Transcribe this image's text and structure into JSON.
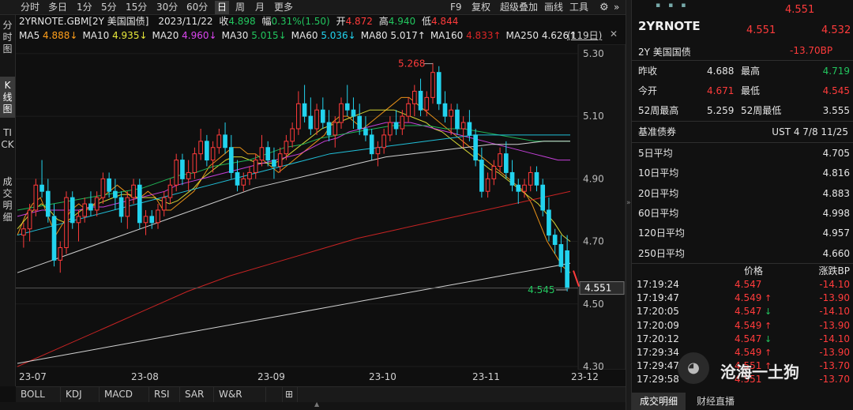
{
  "toolbar": {
    "periods": [
      "分时",
      "多日",
      "1分",
      "5分",
      "15分",
      "30分",
      "60分",
      "日",
      "周",
      "月",
      "更多"
    ],
    "active_period": "日",
    "right_items": [
      "F9",
      "复权",
      "超级叠加",
      "画线",
      "工具"
    ]
  },
  "vtabs": [
    "分时图",
    "K线图",
    "TICK",
    "成交明细"
  ],
  "info": {
    "symbol": "2YRNOTE.GBM[2Y 美国国债]",
    "date": "2023/11/22",
    "close_label": "收",
    "close": "4.898",
    "change_label": "幅",
    "change": "0.31%(1.50)",
    "open_label": "开",
    "open": "4.872",
    "high_label": "高",
    "high": "4.940",
    "low_label": "低",
    "low": "4.844"
  },
  "ma_line": [
    {
      "label": "MA5",
      "value": "4.888↓",
      "color": "#ff9f1a"
    },
    {
      "label": "MA10",
      "value": "4.935↓",
      "color": "#e8e83a"
    },
    {
      "label": "MA20",
      "value": "4.960↓",
      "color": "#d946ef"
    },
    {
      "label": "MA30",
      "value": "5.015↓",
      "color": "#22c55e"
    },
    {
      "label": "MA60",
      "value": "5.036↓",
      "color": "#22d3ee"
    },
    {
      "label": "MA80",
      "value": "5.017↑",
      "color": "#e5e5e5"
    },
    {
      "label": "MA160",
      "value": "4.833↑",
      "color": "#dc2626"
    },
    {
      "label": "MA250",
      "value": "4.626↑",
      "color": "#e5e5e5"
    }
  ],
  "window_label": "(119日)",
  "price_axis": [
    "5.30",
    "5.10",
    "4.90",
    "4.70",
    "4.50",
    "4.30"
  ],
  "date_axis": [
    "23-07",
    "23-08",
    "23-09",
    "23-10",
    "23-11",
    "23-12"
  ],
  "annotations": {
    "high_label": "5.268",
    "low_label": "4.545",
    "last_price": "4.551"
  },
  "indicators": [
    "BOLL",
    "KDJ",
    "MACD",
    "RSI",
    "SAR",
    "W&R",
    "⊞"
  ],
  "quote": {
    "price_top": "4.551",
    "name": "2YRNOTE",
    "price": "4.551",
    "price_prev": "4.532",
    "subname": "2Y 美国国债",
    "change_bp": "-13.70BP",
    "rows": [
      {
        "l1": "昨收",
        "v1": "4.688",
        "c1": "#e5e5e5",
        "l2": "最高",
        "v2": "4.719",
        "c2": "#22c55e"
      },
      {
        "l1": "今开",
        "v1": "4.671",
        "c1": "#ff3b3b",
        "l2": "最低",
        "v2": "4.545",
        "c2": "#ff3b3b"
      },
      {
        "l1": "52周最高",
        "v1": "5.259",
        "c1": "#e5e5e5",
        "l2": "52周最低",
        "v2": "3.555",
        "c2": "#e5e5e5"
      }
    ],
    "bench_label": "基准债券",
    "bench_value": "UST 4 7/8 11/25",
    "averages": [
      {
        "label": "5日平均",
        "value": "4.705"
      },
      {
        "label": "10日平均",
        "value": "4.816"
      },
      {
        "label": "20日平均",
        "value": "4.883"
      },
      {
        "label": "60日平均",
        "value": "4.998"
      },
      {
        "label": "120日平均",
        "value": "4.957"
      },
      {
        "label": "250日平均",
        "value": "4.660"
      }
    ],
    "tick_header": {
      "price": "价格",
      "bp": "涨跌BP"
    },
    "ticks": [
      {
        "time": "17:19:24",
        "price": "4.547",
        "arrow": "",
        "bp": "-14.10"
      },
      {
        "time": "17:19:47",
        "price": "4.549",
        "arrow": "up",
        "bp": "-13.90"
      },
      {
        "time": "17:20:05",
        "price": "4.547",
        "arrow": "down",
        "bp": "-14.10"
      },
      {
        "time": "17:20:09",
        "price": "4.549",
        "arrow": "up",
        "bp": "-13.90"
      },
      {
        "time": "17:20:12",
        "price": "4.547",
        "arrow": "down",
        "bp": "-14.10"
      },
      {
        "time": "17:29:34",
        "price": "4.549",
        "arrow": "up",
        "bp": "-13.90"
      },
      {
        "time": "17:29:47",
        "price": "4.551",
        "arrow": "up",
        "bp": "-13.70"
      },
      {
        "time": "17:29:58",
        "price": "4.551",
        "arrow": "",
        "bp": "-13.70"
      }
    ],
    "bottom_tabs": [
      "成交明细",
      "财经直播"
    ],
    "watermark": "沧海一土狗"
  },
  "chart_data": {
    "type": "candlestick",
    "ylim": [
      4.3,
      5.32
    ],
    "candles": [
      [
        4.72,
        4.76,
        4.68,
        4.74
      ],
      [
        4.74,
        4.82,
        4.7,
        4.8
      ],
      [
        4.8,
        4.9,
        4.78,
        4.88
      ],
      [
        4.88,
        4.96,
        4.84,
        4.86
      ],
      [
        4.86,
        4.9,
        4.76,
        4.78
      ],
      [
        4.78,
        4.82,
        4.62,
        4.64
      ],
      [
        4.64,
        4.7,
        4.6,
        4.68
      ],
      [
        4.68,
        4.86,
        4.66,
        4.84
      ],
      [
        4.84,
        4.86,
        4.74,
        4.76
      ],
      [
        4.76,
        4.8,
        4.7,
        4.78
      ],
      [
        4.78,
        4.84,
        4.76,
        4.82
      ],
      [
        4.82,
        4.86,
        4.78,
        4.8
      ],
      [
        4.8,
        4.86,
        4.78,
        4.84
      ],
      [
        4.84,
        4.92,
        4.82,
        4.9
      ],
      [
        4.9,
        4.92,
        4.84,
        4.86
      ],
      [
        4.86,
        4.9,
        4.8,
        4.84
      ],
      [
        4.84,
        4.86,
        4.76,
        4.78
      ],
      [
        4.78,
        4.86,
        4.74,
        4.84
      ],
      [
        4.84,
        4.9,
        4.82,
        4.88
      ],
      [
        4.88,
        4.9,
        4.74,
        4.76
      ],
      [
        4.76,
        4.8,
        4.72,
        4.78
      ],
      [
        4.78,
        4.8,
        4.74,
        4.76
      ],
      [
        4.76,
        4.82,
        4.74,
        4.8
      ],
      [
        4.8,
        4.86,
        4.78,
        4.84
      ],
      [
        4.84,
        4.9,
        4.82,
        4.88
      ],
      [
        4.88,
        4.98,
        4.86,
        4.96
      ],
      [
        4.96,
        4.98,
        4.88,
        4.9
      ],
      [
        4.9,
        4.96,
        4.86,
        4.92
      ],
      [
        4.92,
        5.0,
        4.9,
        4.98
      ],
      [
        4.98,
        5.06,
        4.96,
        5.02
      ],
      [
        5.02,
        5.04,
        4.94,
        4.96
      ],
      [
        4.96,
        5.02,
        4.92,
        5.0
      ],
      [
        5.0,
        5.06,
        4.98,
        5.04
      ],
      [
        5.04,
        5.08,
        4.98,
        5.0
      ],
      [
        5.0,
        5.04,
        4.9,
        4.92
      ],
      [
        4.92,
        4.96,
        4.86,
        4.88
      ],
      [
        4.88,
        4.92,
        4.86,
        4.9
      ],
      [
        4.9,
        4.94,
        4.88,
        4.92
      ],
      [
        4.92,
        4.98,
        4.9,
        4.96
      ],
      [
        4.96,
        5.04,
        4.94,
        5.0
      ],
      [
        5.0,
        5.02,
        4.94,
        4.96
      ],
      [
        4.96,
        5.0,
        4.9,
        4.94
      ],
      [
        4.94,
        5.0,
        4.92,
        4.98
      ],
      [
        4.98,
        5.04,
        4.96,
        5.02
      ],
      [
        5.02,
        5.08,
        5.0,
        5.06
      ],
      [
        5.06,
        5.18,
        5.04,
        5.14
      ],
      [
        5.14,
        5.2,
        5.08,
        5.1
      ],
      [
        5.1,
        5.16,
        5.04,
        5.06
      ],
      [
        5.06,
        5.14,
        5.04,
        5.12
      ],
      [
        5.12,
        5.16,
        5.06,
        5.08
      ],
      [
        5.08,
        5.12,
        5.02,
        5.04
      ],
      [
        5.04,
        5.1,
        5.0,
        5.08
      ],
      [
        5.08,
        5.16,
        5.06,
        5.14
      ],
      [
        5.14,
        5.2,
        5.1,
        5.12
      ],
      [
        5.12,
        5.16,
        5.06,
        5.1
      ],
      [
        5.1,
        5.14,
        5.04,
        5.06
      ],
      [
        5.06,
        5.1,
        5.02,
        5.04
      ],
      [
        5.04,
        5.06,
        4.96,
        4.98
      ],
      [
        4.98,
        5.02,
        4.94,
        5.0
      ],
      [
        5.0,
        5.06,
        4.98,
        5.04
      ],
      [
        5.04,
        5.1,
        5.02,
        5.08
      ],
      [
        5.08,
        5.12,
        5.04,
        5.06
      ],
      [
        5.06,
        5.12,
        5.04,
        5.1
      ],
      [
        5.1,
        5.16,
        5.08,
        5.14
      ],
      [
        5.14,
        5.2,
        5.1,
        5.18
      ],
      [
        5.18,
        5.22,
        5.1,
        5.12
      ],
      [
        5.12,
        5.18,
        5.1,
        5.16
      ],
      [
        5.16,
        5.27,
        5.14,
        5.24
      ],
      [
        5.24,
        5.26,
        5.12,
        5.14
      ],
      [
        5.14,
        5.18,
        5.08,
        5.1
      ],
      [
        5.1,
        5.14,
        5.04,
        5.12
      ],
      [
        5.12,
        5.14,
        5.04,
        5.06
      ],
      [
        5.06,
        5.1,
        5.0,
        5.08
      ],
      [
        5.08,
        5.12,
        5.02,
        5.04
      ],
      [
        5.04,
        5.06,
        4.94,
        4.96
      ],
      [
        4.96,
        5.0,
        4.84,
        4.86
      ],
      [
        4.86,
        4.92,
        4.84,
        4.9
      ],
      [
        4.9,
        4.96,
        4.88,
        4.94
      ],
      [
        4.94,
        5.0,
        4.92,
        4.98
      ],
      [
        4.98,
        5.02,
        4.9,
        4.92
      ],
      [
        4.92,
        4.96,
        4.86,
        4.88
      ],
      [
        4.88,
        4.9,
        4.82,
        4.86
      ],
      [
        4.86,
        4.9,
        4.84,
        4.88
      ],
      [
        4.88,
        4.94,
        4.86,
        4.92
      ],
      [
        4.92,
        4.94,
        4.86,
        4.88
      ],
      [
        4.88,
        4.9,
        4.78,
        4.8
      ],
      [
        4.8,
        4.84,
        4.7,
        4.72
      ],
      [
        4.72,
        4.74,
        4.66,
        4.69
      ],
      [
        4.69,
        4.72,
        4.6,
        4.62
      ],
      [
        4.67,
        4.72,
        4.54,
        4.55
      ]
    ],
    "ma_lines": [
      {
        "name": "MA5",
        "color": "#ff9f1a",
        "values": [
          4.72,
          4.78,
          4.82,
          4.84,
          4.78,
          4.72,
          4.76,
          4.8,
          4.82,
          4.8,
          4.82,
          4.84,
          4.86,
          4.88,
          4.86,
          4.84,
          4.84,
          4.86,
          4.84,
          4.8,
          4.8,
          4.82,
          4.84,
          4.86,
          4.9,
          4.94,
          4.96,
          4.98,
          5.0,
          5.0,
          4.98,
          4.98,
          4.96,
          4.94,
          4.92,
          4.94,
          4.96,
          4.98,
          5.0,
          5.02,
          5.04,
          5.08,
          5.1,
          5.1,
          5.08,
          5.06,
          5.08,
          5.1,
          5.12,
          5.14,
          5.16,
          5.16,
          5.14,
          5.12,
          5.1,
          5.08,
          5.06,
          5.04,
          5.02,
          5.0,
          4.98,
          4.96,
          4.94,
          4.92,
          4.9,
          4.88,
          4.86,
          4.82,
          4.76,
          4.7,
          4.66,
          4.62,
          4.6
        ]
      },
      {
        "name": "MA10",
        "color": "#e8e83a",
        "values": [
          4.74,
          4.77,
          4.8,
          4.82,
          4.8,
          4.77,
          4.76,
          4.78,
          4.8,
          4.81,
          4.82,
          4.83,
          4.84,
          4.85,
          4.85,
          4.84,
          4.84,
          4.84,
          4.83,
          4.82,
          4.83,
          4.85,
          4.87,
          4.9,
          4.92,
          4.94,
          4.96,
          4.97,
          4.97,
          4.96,
          4.95,
          4.95,
          4.95,
          4.96,
          4.98,
          5.0,
          5.02,
          5.04,
          5.06,
          5.07,
          5.08,
          5.09,
          5.1,
          5.11,
          5.12,
          5.12,
          5.12,
          5.12,
          5.11,
          5.1,
          5.09,
          5.08,
          5.06,
          5.05,
          5.03,
          5.01,
          4.99,
          4.97,
          4.95,
          4.93,
          4.92,
          4.9,
          4.88,
          4.86,
          4.84,
          4.82,
          4.79,
          4.76,
          4.72,
          4.7
        ]
      },
      {
        "name": "MA20",
        "color": "#d946ef",
        "values": [
          4.78,
          4.79,
          4.8,
          4.8,
          4.8,
          4.8,
          4.81,
          4.81,
          4.82,
          4.83,
          4.84,
          4.85,
          4.86,
          4.88,
          4.89,
          4.9,
          4.91,
          4.92,
          4.93,
          4.94,
          4.95,
          4.96,
          4.97,
          4.98,
          5.0,
          5.02,
          5.03,
          5.05,
          5.06,
          5.07,
          5.08,
          5.08,
          5.08,
          5.07,
          5.06,
          5.05,
          5.04,
          5.03,
          5.02,
          5.01,
          5.0,
          4.99,
          4.98,
          4.97,
          4.96,
          4.96
        ]
      },
      {
        "name": "MA30",
        "color": "#22c55e",
        "values": [
          4.8,
          4.81,
          4.82,
          4.83,
          4.84,
          4.85,
          4.86,
          4.87,
          4.89,
          4.91,
          4.92,
          4.94,
          4.95,
          4.96,
          4.98,
          5.0,
          5.01,
          5.03,
          5.04,
          5.05,
          5.06,
          5.07,
          5.07,
          5.07,
          5.06,
          5.06,
          5.05,
          5.04,
          5.03,
          5.02,
          5.02,
          5.02
        ]
      },
      {
        "name": "MA60",
        "color": "#22d3ee",
        "values": [
          4.72,
          4.74,
          4.76,
          4.78,
          4.8,
          4.82,
          4.84,
          4.86,
          4.88,
          4.9,
          4.92,
          4.94,
          4.96,
          4.98,
          4.99,
          5.0,
          5.01,
          5.02,
          5.03,
          5.04,
          5.04,
          5.04,
          5.04,
          5.04
        ]
      },
      {
        "name": "MA80",
        "color": "#e5e5e5",
        "values": [
          4.6,
          4.63,
          4.66,
          4.69,
          4.72,
          4.75,
          4.78,
          4.81,
          4.84,
          4.87,
          4.89,
          4.91,
          4.93,
          4.95,
          4.97,
          4.98,
          4.99,
          5.0,
          5.01,
          5.01,
          5.02,
          5.02
        ]
      },
      {
        "name": "MA160",
        "color": "#dc2626",
        "values": [
          4.3,
          4.36,
          4.42,
          4.48,
          4.54,
          4.59,
          4.63,
          4.67,
          4.71,
          4.74,
          4.77,
          4.8,
          4.83,
          4.86
        ]
      },
      {
        "name": "MA250",
        "color": "#e5e5e5",
        "values": [
          4.31,
          4.33,
          4.35,
          4.37,
          4.39,
          4.41,
          4.43,
          4.45,
          4.47,
          4.49,
          4.51,
          4.53,
          4.55,
          4.57,
          4.59,
          4.61,
          4.63
        ]
      }
    ]
  }
}
